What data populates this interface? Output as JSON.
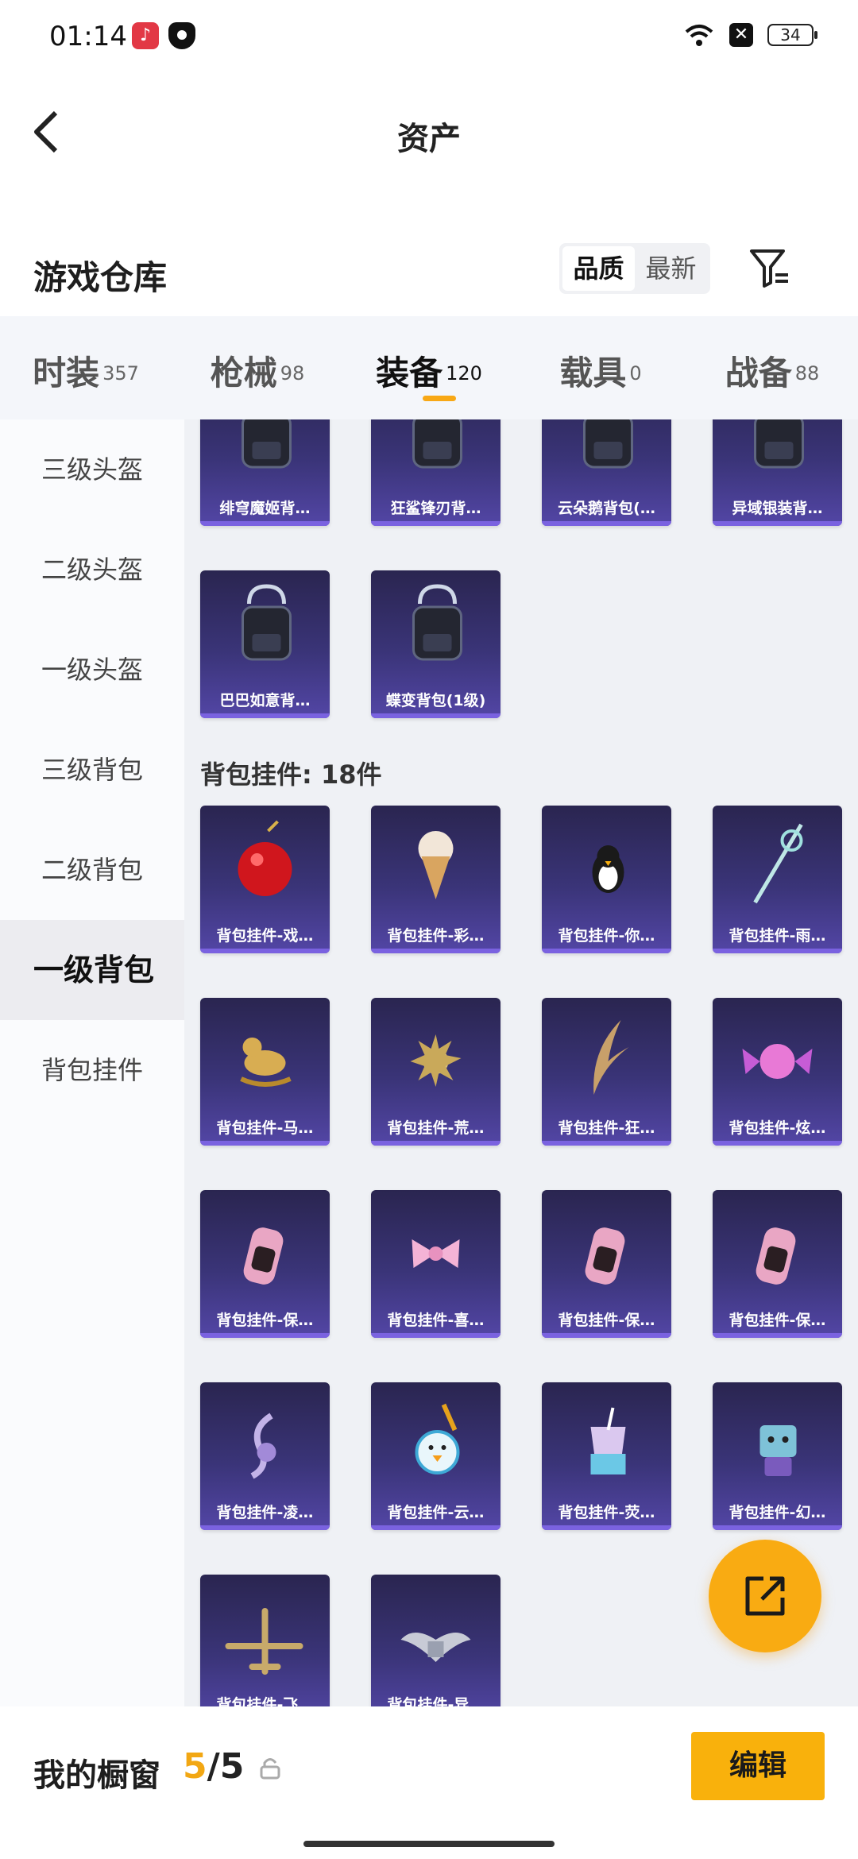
{
  "status_bar": {
    "time": "01:14",
    "battery": "34"
  },
  "header": {
    "title": "资产"
  },
  "section": {
    "title": "游戏仓库",
    "sort_options": [
      "品质",
      "最新"
    ]
  },
  "tabs": [
    {
      "label": "时装",
      "count": "357"
    },
    {
      "label": "枪械",
      "count": "98"
    },
    {
      "label": "装备",
      "count": "120"
    },
    {
      "label": "载具",
      "count": "0"
    },
    {
      "label": "战备",
      "count": "88"
    }
  ],
  "sidebar": [
    "三级头盔",
    "二级头盔",
    "一级头盔",
    "三级背包",
    "二级背包",
    "一级背包",
    "背包挂件"
  ],
  "backpacks": [
    {
      "label": "绯穹魔姬背…",
      "icon": "backpack-icon"
    },
    {
      "label": "狂鲨锋刃背…",
      "icon": "backpack-icon"
    },
    {
      "label": "云朵鹅背包(…",
      "icon": "backpack-icon"
    },
    {
      "label": "异域银装背…",
      "icon": "backpack-icon"
    },
    {
      "label": "巴巴如意背…",
      "icon": "backpack-icon"
    },
    {
      "label": "蝶变背包(1级)",
      "icon": "backpack-icon"
    }
  ],
  "charm_group_title": "背包挂件: 18件",
  "charms": [
    {
      "label": "背包挂件-戏…",
      "icon": "apple-charm-icon"
    },
    {
      "label": "背包挂件-彩…",
      "icon": "ice-cream-charm-icon"
    },
    {
      "label": "背包挂件-你…",
      "icon": "penguin-charm-icon"
    },
    {
      "label": "背包挂件-雨…",
      "icon": "staff-charm-icon"
    },
    {
      "label": "背包挂件-马…",
      "icon": "horse-charm-icon"
    },
    {
      "label": "背包挂件-荒…",
      "icon": "sun-charm-icon"
    },
    {
      "label": "背包挂件-狂…",
      "icon": "fin-charm-icon"
    },
    {
      "label": "背包挂件-炫…",
      "icon": "candy-charm-icon"
    },
    {
      "label": "背包挂件-保…",
      "icon": "tag-charm-icon"
    },
    {
      "label": "背包挂件-喜…",
      "icon": "bow-charm-icon"
    },
    {
      "label": "背包挂件-保…",
      "icon": "tag-charm-icon"
    },
    {
      "label": "背包挂件-保…",
      "icon": "tag-charm-icon"
    },
    {
      "label": "背包挂件-凌…",
      "icon": "swirl-charm-icon"
    },
    {
      "label": "背包挂件-云…",
      "icon": "duck-charm-icon"
    },
    {
      "label": "背包挂件-荧…",
      "icon": "drink-charm-icon"
    },
    {
      "label": "背包挂件-幻…",
      "icon": "robot-charm-icon"
    },
    {
      "label": "背包挂件-飞…",
      "icon": "plane-charm-icon"
    },
    {
      "label": "背包挂件-异…",
      "icon": "wings-charm-icon"
    }
  ],
  "bottom": {
    "label": "我的橱窗",
    "current": "5",
    "total": "/5",
    "edit_label": "编辑"
  },
  "colors": {
    "accent": "#f9ab12",
    "card": "#3a3478"
  }
}
